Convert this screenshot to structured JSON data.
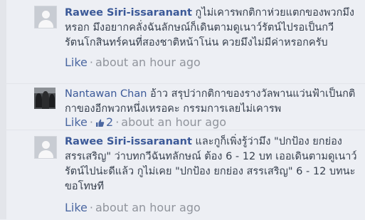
{
  "comments": [
    {
      "author": "Rawee Siri-issaranant",
      "text": "กูไม่เคารพกติกาห่วยแตกของพวกมึงหรอก มึงอยากคลั่งฉันลักษณ์ก็เดินตามดูเนาว์รัตน์ไปรอเป็นกวีรัตนโกสินทร์คนที่สองชาติหน้าโน่น ควยมึงไม่มีค่าหรอกครับ",
      "like_label": "Like",
      "separator": "·",
      "time": "about an hour ago",
      "avatar_icon": "default-profile-icon"
    },
    {
      "author": "Nantawan Chan",
      "text": "อ้าว สรุปว่ากติกาของรางวัลพานแว่นฟ้าเป็นกติกาของอีกพวกหนึ่งเหรอคะ กรรมการเลยไม่เคารพ",
      "like_label": "Like",
      "separator": "·",
      "like_count": "2",
      "time": "about an hour ago",
      "avatar_icon": "profile-photo-icon"
    },
    {
      "author": "Rawee Siri-issaranant",
      "text": "และกูก็เพิ่งรู้ว่ามึง \"ปกป้อง ยกย่อง สรรเสริญ\" ว่าบทกวีฉันทลักษณ์ ต้อง 6 - 12 บท เออเดินตามดูเนาว์รัตน์ไปน่ะดีแล้ว กูไม่เคย \"ปกป้อง ยกย่อง สรรเสริญ\" 6 - 12 บทนะ ขอโทษที",
      "like_label": "Like",
      "separator": "·",
      "time": "about an hour ago",
      "avatar_icon": "default-profile-icon"
    }
  ],
  "colors": {
    "background": "#edeff4",
    "author": "#3b5998",
    "link": "#4b67a1",
    "muted": "#90949c",
    "body_text": "#37404e"
  }
}
